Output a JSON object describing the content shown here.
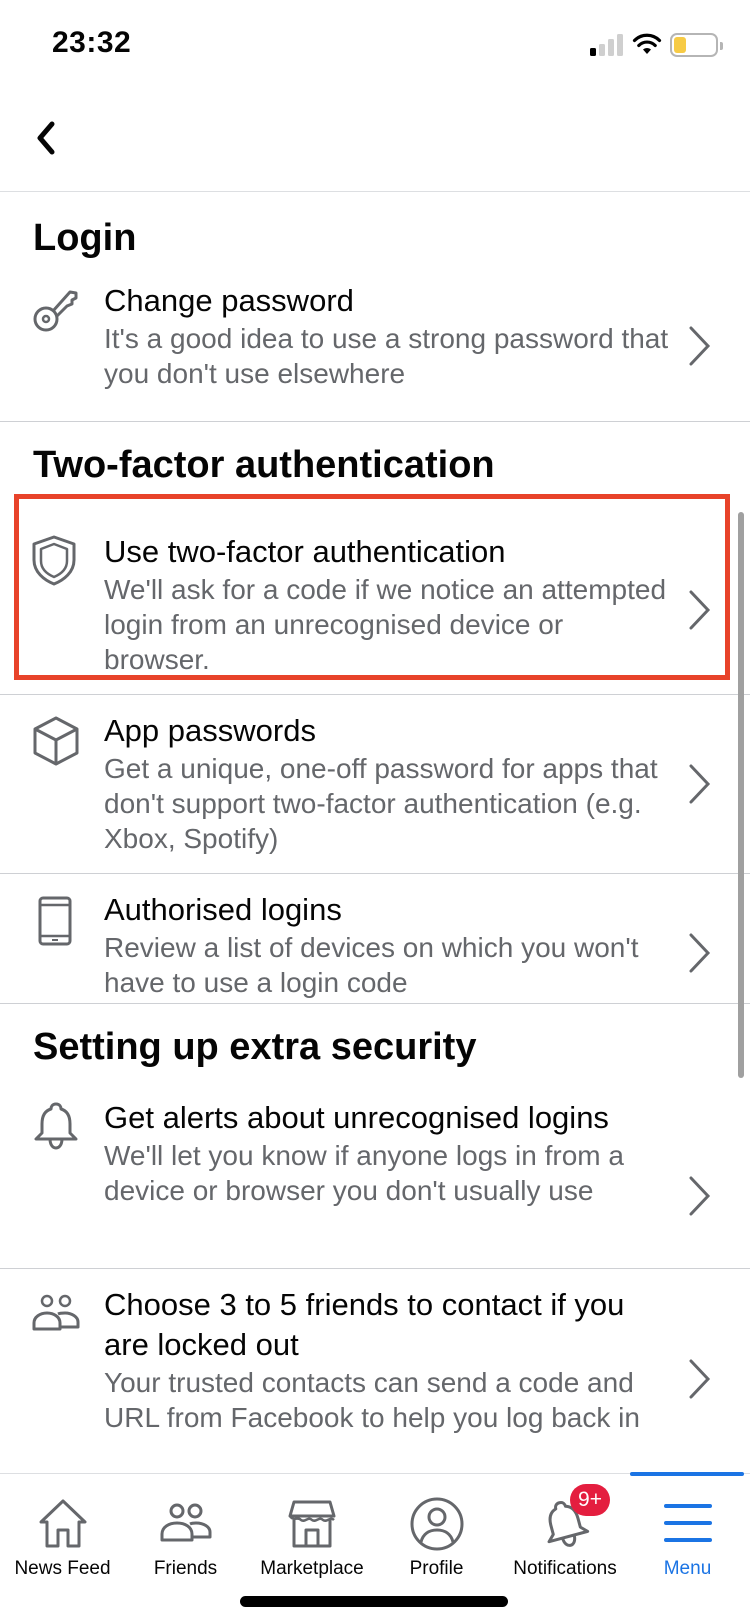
{
  "status_bar": {
    "time": "23:32",
    "signal_bars_active": 1,
    "signal_bars_total": 4,
    "battery_level_pct": 25,
    "battery_color": "#f7cb45"
  },
  "nav": {
    "back_icon": "chevron-left-icon"
  },
  "sections": [
    {
      "title": "Login",
      "items": [
        {
          "icon": "key-icon",
          "title": "Change password",
          "description": "It's a good idea to use a strong password that you don't use elsewhere"
        }
      ]
    },
    {
      "title": "Two-factor authentication",
      "items": [
        {
          "icon": "shield-icon",
          "title": "Use two-factor authentication",
          "description": "We'll ask for a code if we notice an attempted login from an unrecognised device or browser.",
          "highlighted": true
        },
        {
          "icon": "cube-icon",
          "title": "App passwords",
          "description": "Get a unique, one-off password for apps that don't support two-factor authentication (e.g. Xbox, Spotify)"
        },
        {
          "icon": "phone-icon",
          "title": "Authorised logins",
          "description": "Review a list of devices on which you won't have to use a login code"
        }
      ]
    },
    {
      "title": "Setting up extra security",
      "items": [
        {
          "icon": "bell-icon",
          "title": "Get alerts about unrecognised logins",
          "description": "We'll let you know if anyone logs in from a device or browser you don't usually use"
        },
        {
          "icon": "friends-icon",
          "title": "Choose 3 to 5 friends to contact if you are locked out",
          "description": "Your trusted contacts can send a code and URL from Facebook to help you log back in"
        }
      ]
    }
  ],
  "highlight_color": "#e8432a",
  "tab_bar": {
    "active_color": "#1b74e4",
    "tabs": [
      {
        "label": "News Feed",
        "icon": "home-icon"
      },
      {
        "label": "Friends",
        "icon": "friends-icon"
      },
      {
        "label": "Marketplace",
        "icon": "shop-icon"
      },
      {
        "label": "Profile",
        "icon": "profile-icon"
      },
      {
        "label": "Notifications",
        "icon": "bell-icon",
        "badge": "9+"
      },
      {
        "label": "Menu",
        "icon": "menu-icon",
        "active": true
      }
    ]
  }
}
